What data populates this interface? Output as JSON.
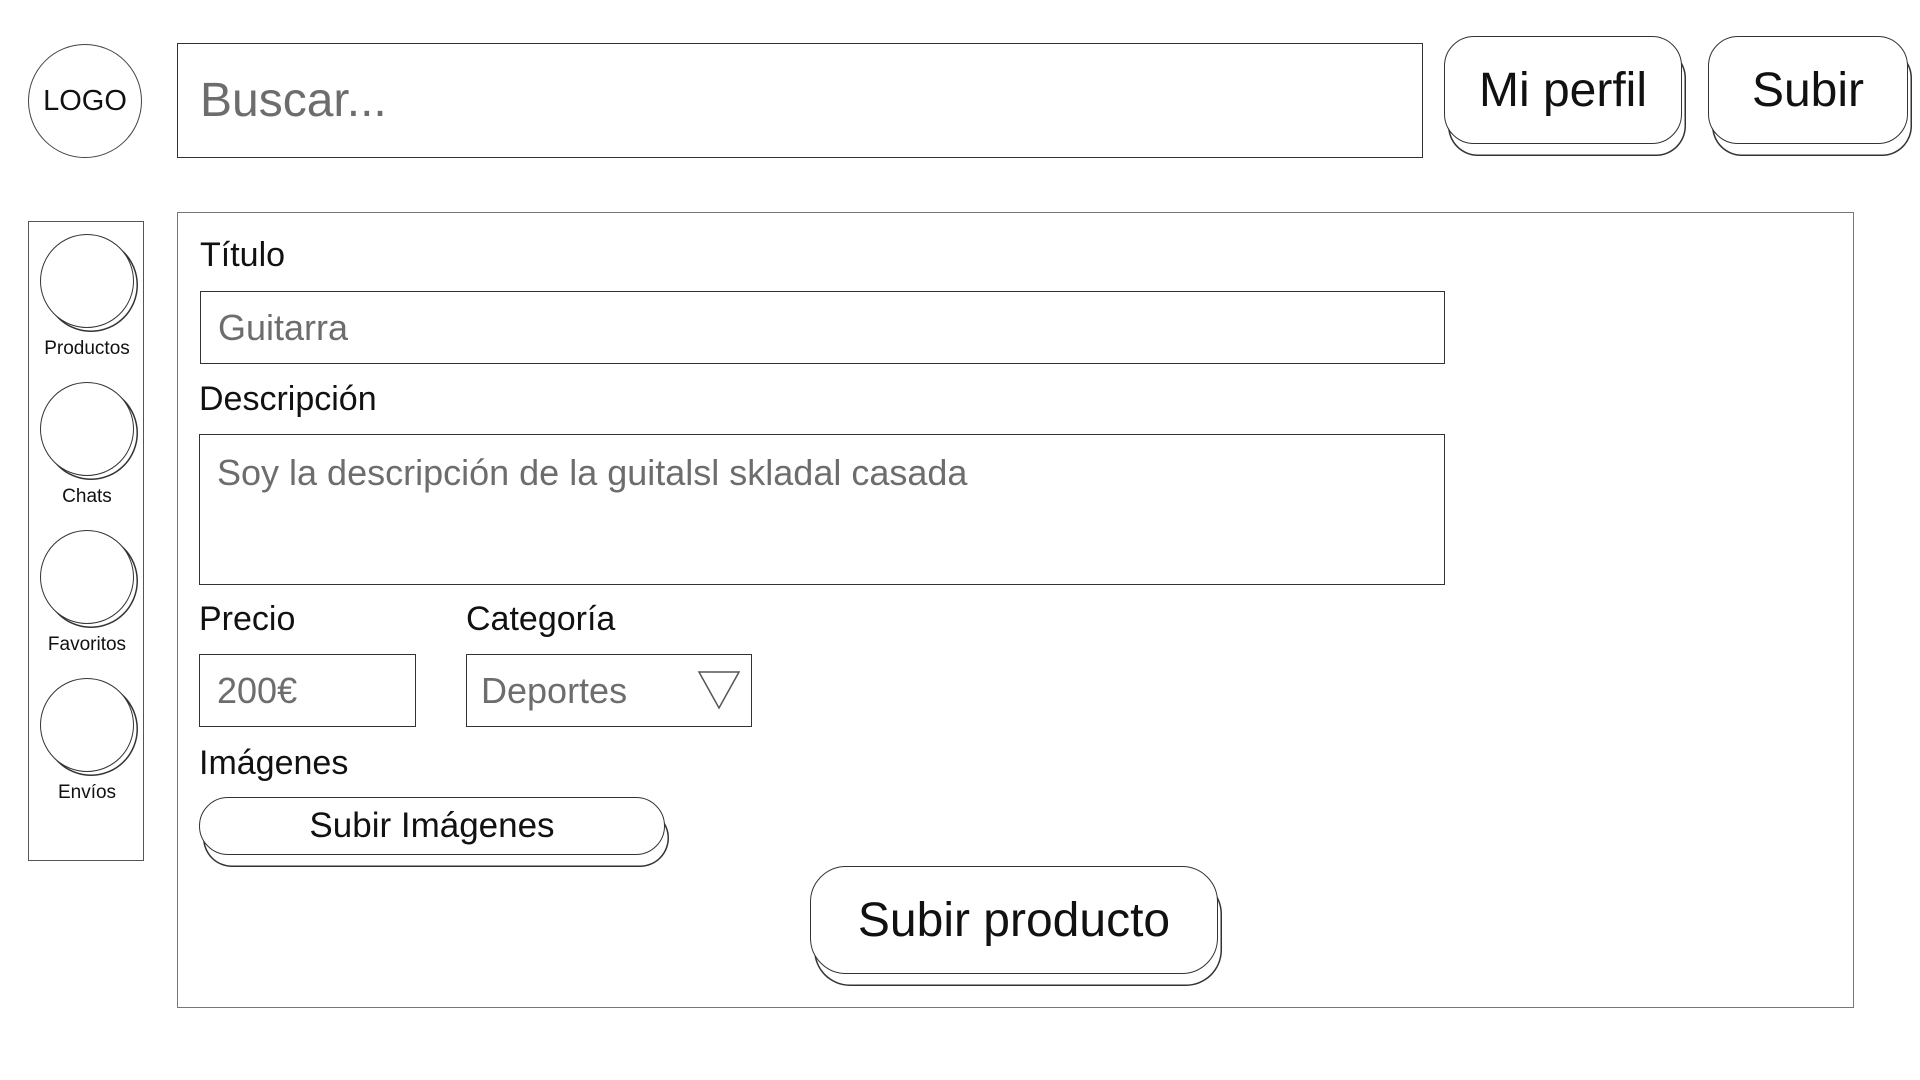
{
  "header": {
    "logo_text": "LOGO",
    "search_placeholder": "Buscar...",
    "profile_button": "Mi perfil",
    "upload_button": "Subir"
  },
  "sidebar": {
    "items": [
      {
        "label": "Productos",
        "icon": "circle-placeholder-icon"
      },
      {
        "label": "Chats",
        "icon": "circle-placeholder-icon"
      },
      {
        "label": "Favoritos",
        "icon": "circle-placeholder-icon"
      },
      {
        "label": "Envíos",
        "icon": "circle-placeholder-icon"
      }
    ]
  },
  "form": {
    "title_label": "Título",
    "title_value": "Guitarra",
    "description_label": "Descripción",
    "description_value": "Soy la descripción de la guitalsl skladal casada",
    "price_label": "Precio",
    "price_value": "200€",
    "category_label": "Categoría",
    "category_value": "Deportes",
    "category_icon": "dropdown-triangle-icon",
    "images_label": "Imágenes",
    "images_button": "Subir Imágenes",
    "submit_button": "Subir producto"
  }
}
